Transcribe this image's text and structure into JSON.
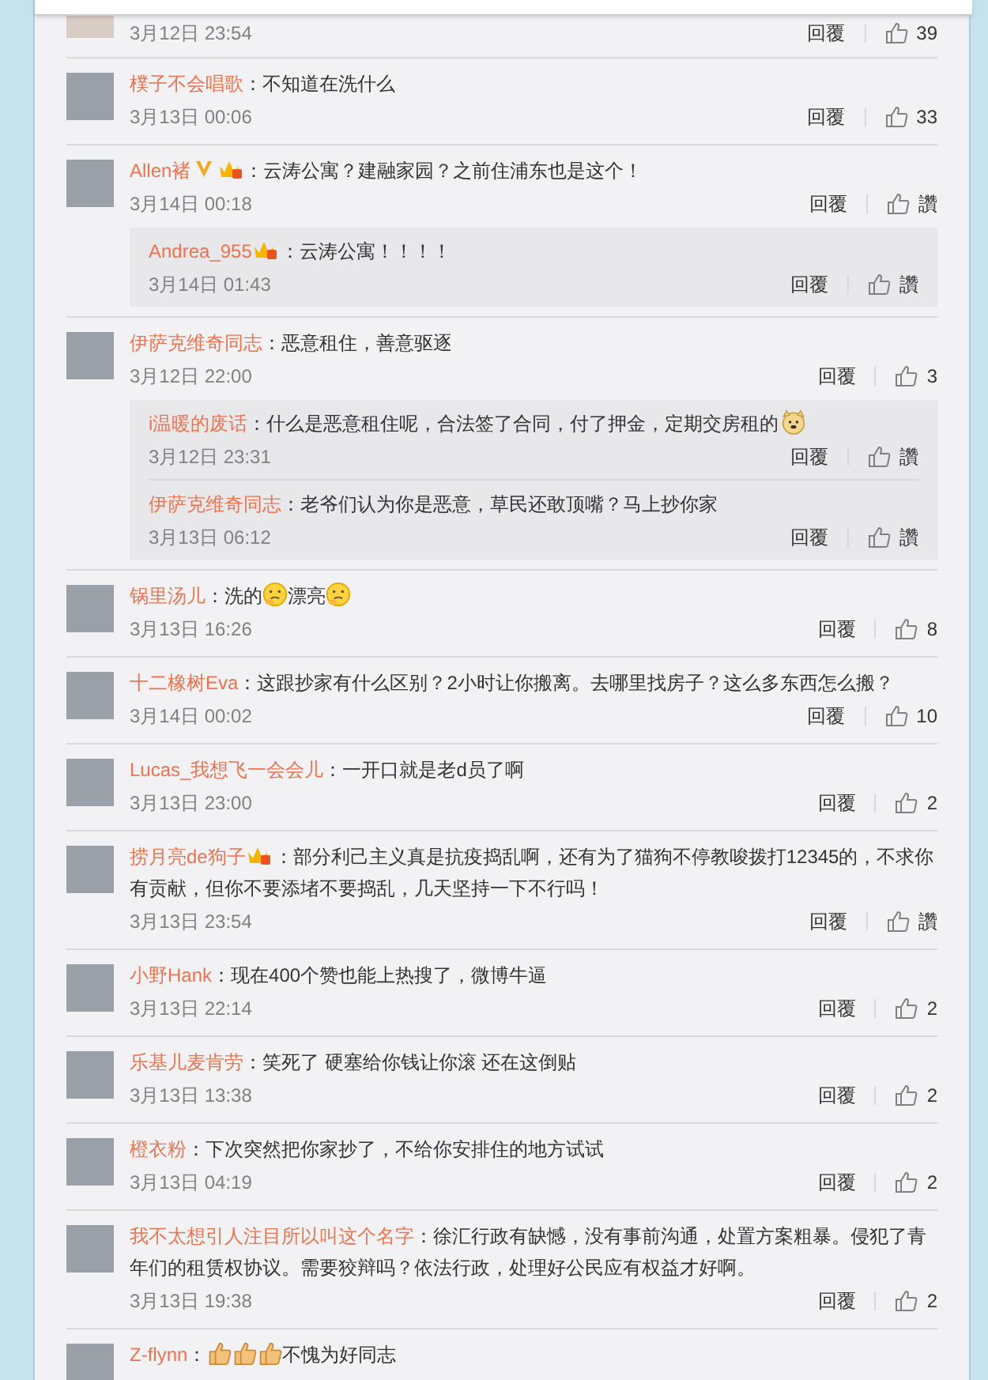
{
  "comments": [
    {
      "date": "3月12日 23:54",
      "reply": "回覆",
      "like": "39"
    },
    {
      "name": "樸子不会唱歌",
      "colon": "：",
      "content": [
        {
          "kind": "text",
          "text": "不知道在洗什么"
        }
      ],
      "date": "3月13日 00:06",
      "reply": "回覆",
      "like": "33"
    },
    {
      "name": "Allen褚",
      "badges": [
        {
          "kind": "verified"
        },
        {
          "kind": "member"
        }
      ],
      "colon": "：",
      "content": [
        {
          "kind": "text",
          "text": "云涛公寓？建融家园？之前住浦东也是这个！"
        }
      ],
      "date": "3月14日 00:18",
      "reply": "回覆",
      "like": "讚",
      "replies": [
        {
          "name": "Andrea_955",
          "badges": [
            {
              "kind": "member"
            }
          ],
          "colon": "：",
          "content": [
            {
              "kind": "text",
              "text": "云涛公寓！！！！"
            }
          ],
          "date": "3月14日 01:43",
          "reply": "回覆",
          "like": "讚"
        }
      ]
    },
    {
      "name": "伊萨克维奇同志",
      "colon": "：",
      "content": [
        {
          "kind": "text",
          "text": "恶意租住，善意驱逐"
        }
      ],
      "date": "3月12日 22:00",
      "reply": "回覆",
      "like": "3",
      "replies": [
        {
          "name": "i温暖的废话",
          "colon": "：",
          "content": [
            {
              "kind": "text",
              "text": "什么是恶意租住呢，合法签了合同，付了押金，定期交房租的"
            },
            {
              "kind": "doge"
            }
          ],
          "date": "3月12日 23:31",
          "reply": "回覆",
          "like": "讚"
        },
        {
          "name": "伊萨克维奇同志",
          "colon": "：",
          "content": [
            {
              "kind": "text",
              "text": "老爷们认为你是恶意，草民还敢顶嘴？马上抄你家"
            }
          ],
          "date": "3月13日 06:12",
          "reply": "回覆",
          "like": "讚"
        }
      ]
    },
    {
      "name": "锅里汤儿",
      "colon": "：",
      "content": [
        {
          "kind": "text",
          "text": "洗的"
        },
        {
          "kind": "thinking"
        },
        {
          "kind": "text",
          "text": "漂亮"
        },
        {
          "kind": "thinking"
        }
      ],
      "date": "3月13日 16:26",
      "reply": "回覆",
      "like": "8"
    },
    {
      "name": "十二橡树Eva",
      "colon": "：",
      "content": [
        {
          "kind": "text",
          "text": "这跟抄家有什么区别？2小时让你搬离。去哪里找房子？这么多东西怎么搬？"
        }
      ],
      "date": "3月14日 00:02",
      "reply": "回覆",
      "like": "10"
    },
    {
      "name": "Lucas_我想飞一会会儿",
      "colon": "：",
      "content": [
        {
          "kind": "text",
          "text": "一开口就是老d员了啊"
        }
      ],
      "date": "3月13日 23:00",
      "reply": "回覆",
      "like": "2"
    },
    {
      "name": "捞月亮de狗子",
      "badges": [
        {
          "kind": "member"
        }
      ],
      "colon": "：",
      "content": [
        {
          "kind": "text",
          "text": "部分利己主义真是抗疫捣乱啊，还有为了猫狗不停教唆拨打12345的，不求你"
        },
        {
          "kind": "text",
          "text": "有贡献，但你不要添堵不要捣乱，几天坚持一下不行吗！"
        }
      ],
      "date": "3月13日 23:54",
      "reply": "回覆",
      "like": "讚"
    },
    {
      "name": "小野Hank",
      "colon": "：",
      "content": [
        {
          "kind": "text",
          "text": "现在400个赞也能上热搜了，微博牛逼"
        }
      ],
      "date": "3月13日 22:14",
      "reply": "回覆",
      "like": "2"
    },
    {
      "name": "乐基儿麦肯劳",
      "colon": "：",
      "content": [
        {
          "kind": "text",
          "text": "笑死了 硬塞给你钱让你滚 还在这倒贴"
        }
      ],
      "date": "3月13日 13:38",
      "reply": "回覆",
      "like": "2"
    },
    {
      "name": "橙衣粉",
      "colon": "：",
      "content": [
        {
          "kind": "text",
          "text": "下次突然把你家抄了，不给你安排住的地方试试"
        }
      ],
      "date": "3月13日 04:19",
      "reply": "回覆",
      "like": "2"
    },
    {
      "name": "我不太想引人注目所以叫这个名字",
      "colon": "：",
      "content": [
        {
          "kind": "text",
          "text": "徐汇行政有缺憾，没有事前沟通，处置方案粗暴。侵犯了青"
        },
        {
          "kind": "text",
          "text": "年们的租赁权协议。需要狡辩吗？依法行政，处理好公民应有权益才好啊。"
        }
      ],
      "date": "3月13日 19:38",
      "reply": "回覆",
      "like": "2"
    },
    {
      "name": "Z-flynn",
      "colon": "：",
      "content": [
        {
          "kind": "thumbs"
        },
        {
          "kind": "thumbs"
        },
        {
          "kind": "thumbs"
        },
        {
          "kind": "text",
          "text": "不愧为好同志"
        }
      ]
    }
  ]
}
